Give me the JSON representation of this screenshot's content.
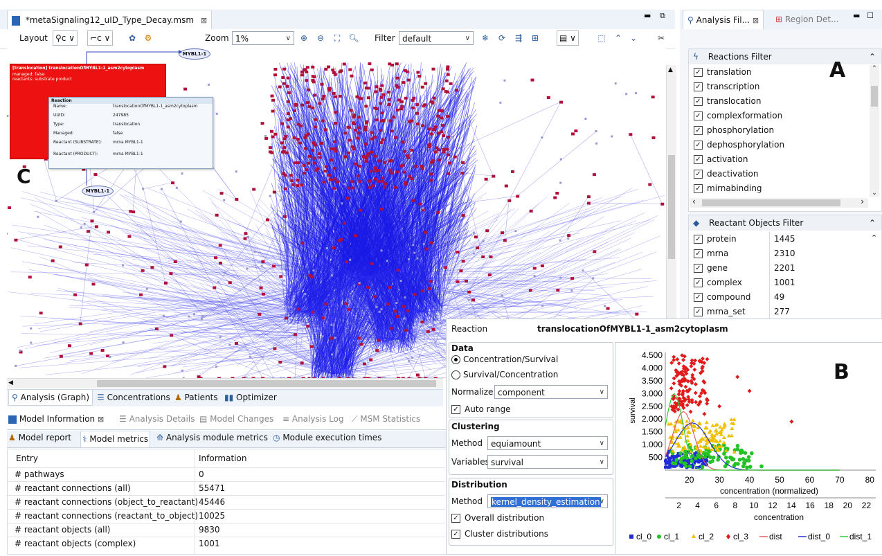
{
  "editor": {
    "title": "*metaSignaling12_uID_Type_Decay.msm",
    "toolbar": {
      "layout_label": "Layout",
      "zoom_label": "Zoom",
      "zoom_value": "1%",
      "filter_label": "Filter",
      "filter_value": "default"
    },
    "big_letter_c": "C",
    "graph": {
      "node_top": "MYBL1-1",
      "node_bottom": "MYBL1-1",
      "red_popup": {
        "title": "[translocation] translocationOfMYBL1-1_asm2cytoplasm",
        "line1": "managed: false",
        "line2": "reactants: substrate product"
      },
      "info_popup": {
        "header": "Reaction",
        "rows": [
          {
            "k": "Name:",
            "v": "translocationOfMYBL1-1_asm2cytoplasm"
          },
          {
            "k": "UUID:",
            "v": "247985"
          },
          {
            "k": "Type:",
            "v": "translocation"
          },
          {
            "k": "Managed:",
            "v": "false"
          },
          {
            "k": "Reactant (SUBSTRATE):",
            "v": "mrna   MYBL1-1"
          },
          {
            "k": "Reactant (PRODUCT):",
            "v": "mrna   MYBL1-1"
          }
        ]
      }
    },
    "bottom_tabs": [
      "Analysis (Graph)",
      "Concentrations",
      "Patients",
      "Optimizer"
    ]
  },
  "right_panel": {
    "tabs": [
      "Analysis Fil...",
      "Region Det..."
    ],
    "big_letter_a": "A",
    "reactions_filter": {
      "title": "Reactions Filter",
      "items": [
        "translation",
        "transcription",
        "translocation",
        "complexformation",
        "phosphorylation",
        "dephosphorylation",
        "activation",
        "deactivation",
        "mirnabinding"
      ]
    },
    "reactant_filter": {
      "title": "Reactant Objects Filter",
      "items": [
        {
          "name": "protein",
          "count": "1445"
        },
        {
          "name": "mrna",
          "count": "2310"
        },
        {
          "name": "gene",
          "count": "2201"
        },
        {
          "name": "complex",
          "count": "1001"
        },
        {
          "name": "compound",
          "count": "49"
        },
        {
          "name": "mrna_set",
          "count": "277"
        }
      ]
    }
  },
  "model_info": {
    "tabs": [
      "Model Information",
      "Analysis Details",
      "Model Changes",
      "Analysis Log",
      "MSM Statistics"
    ],
    "subtabs": [
      "Model report",
      "Model metrics",
      "Analysis module metrics",
      "Module execution times"
    ],
    "table": {
      "headers": [
        "Entry",
        "Information"
      ],
      "rows": [
        [
          "# pathways",
          "0"
        ],
        [
          "# reactant connections (all)",
          "55471"
        ],
        [
          "# reactant connections (object_to_reactant)",
          "45446"
        ],
        [
          "# reactant connections (reactant_to_object)",
          "10025"
        ],
        [
          "# reactant objects (all)",
          "9830"
        ],
        [
          "# reactant objects (complex)",
          "1001"
        ]
      ]
    }
  },
  "analysis_panel": {
    "reaction_label": "Reaction",
    "reaction_value": "translocationOfMYBL1-1_asm2cytoplasm",
    "data_title": "Data",
    "radio_conc_surv": "Concentration/Survival",
    "radio_surv_conc": "Survival/Concentration",
    "normalize_label": "Normalize",
    "normalize_value": "component",
    "auto_range": "Auto range",
    "clustering_title": "Clustering",
    "method_label": "Method",
    "method_value": "equiamount",
    "variables_label": "Variables",
    "variables_value": "survival",
    "distribution_title": "Distribution",
    "dist_method_label": "Method",
    "dist_method_value": "kernel_density_estimation",
    "overall_distribution": "Overall distribution",
    "cluster_distributions": "Cluster distributions",
    "big_letter_b": "B"
  },
  "chart_data": {
    "type": "scatter",
    "ylabel": "survival",
    "xlabel_top": "concentration (normalized)",
    "xlabel_bottom": "concentration",
    "y_ticks": [
      "4.500",
      "4.000",
      "3.500",
      "3.000",
      "2.500",
      "2.000",
      "1.500",
      "1.000",
      "500"
    ],
    "y_tick_values": [
      4500,
      4000,
      3500,
      3000,
      2500,
      2000,
      1500,
      1000,
      500
    ],
    "x_ticks_top": [
      "20",
      "30",
      "40",
      "50",
      "60",
      "70",
      "80"
    ],
    "x_ticks_bottom": [
      "2",
      "4",
      "6",
      "8",
      "10",
      "12",
      "14",
      "16",
      "18",
      "20",
      "22"
    ],
    "legend": [
      "cl_0",
      "cl_1",
      "cl_2",
      "cl_3",
      "dist",
      "dist_0",
      "dist_1"
    ],
    "colors": {
      "cl_0": "#1f2bd6",
      "cl_1": "#22c322",
      "cl_2": "#f0c000",
      "cl_3": "#e11b1b",
      "dist": "#e06060",
      "dist_0": "#2233cc",
      "dist_1": "#33cc33"
    }
  }
}
